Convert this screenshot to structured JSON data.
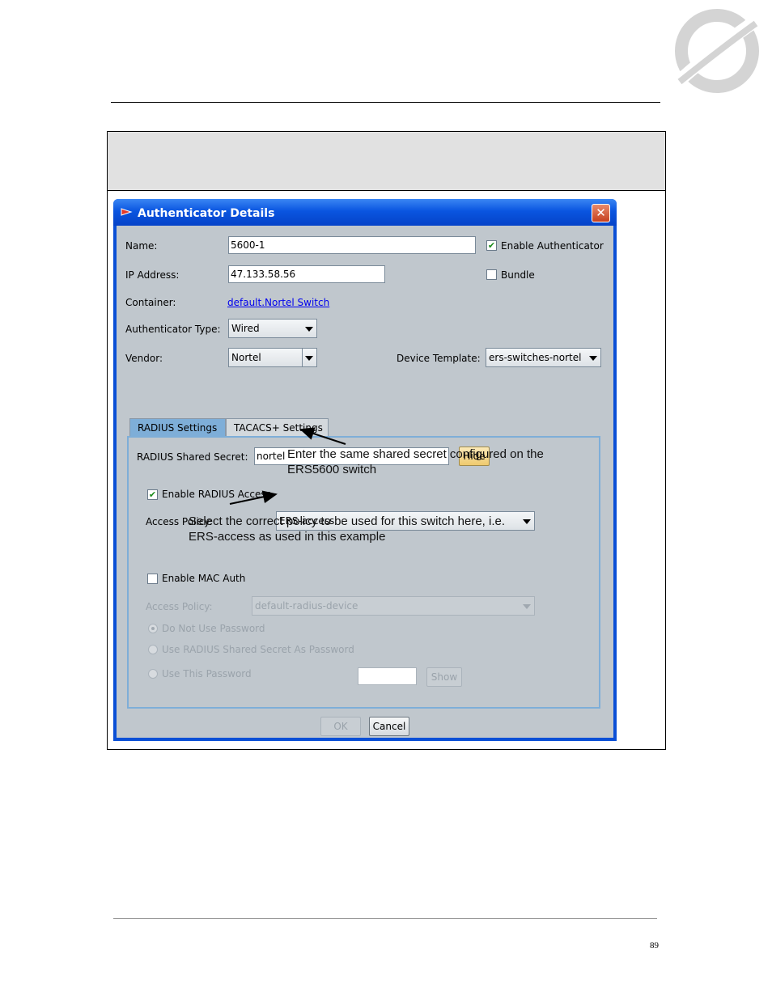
{
  "page": {
    "page_number": "89"
  },
  "dialog": {
    "title": "Authenticator Details",
    "close_symbol": "✕",
    "name_label": "Name:",
    "name_value": "5600-1",
    "enable_authenticator_label": "Enable Authenticator",
    "enable_authenticator_checked": true,
    "ip_label": "IP Address:",
    "ip_value": "47.133.58.56",
    "bundle_label": "Bundle",
    "bundle_checked": false,
    "container_label": "Container:",
    "container_value": "default.Nortel Switch",
    "auth_type_label": "Authenticator Type:",
    "auth_type_value": "Wired",
    "vendor_label": "Vendor:",
    "vendor_value": "Nortel",
    "device_template_label": "Device Template:",
    "device_template_value": "ers-switches-nortel",
    "tabs": [
      {
        "label": "RADIUS Settings",
        "active": true
      },
      {
        "label": "TACACS+ Settings",
        "active": false
      }
    ],
    "radius": {
      "shared_secret_label": "RADIUS Shared Secret:",
      "shared_secret_value": "nortel",
      "hide_button": "Hide",
      "enable_radius_access_label": "Enable RADIUS Access",
      "enable_radius_access_checked": true,
      "access_policy_label": "Access Policy:",
      "access_policy_value": "ERS-access",
      "enable_mac_auth_label": "Enable MAC Auth",
      "enable_mac_auth_checked": false,
      "mac_access_policy_label": "Access Policy:",
      "mac_access_policy_value": "default-radius-device",
      "radio_options": [
        "Do Not Use Password",
        "Use RADIUS Shared Secret As Password",
        "Use This Password"
      ],
      "show_button": "Show"
    },
    "ok_button": "OK",
    "cancel_button": "Cancel"
  },
  "annotations": {
    "secret_note_line1": "Enter the same shared secret configured on the",
    "secret_note_line2": "ERS5600 switch",
    "policy_note_line1": "Select the correct policy to be used for this switch here, i.e.",
    "policy_note_line2": "ERS-access as used in this example"
  },
  "colors": {
    "titlebar": "#0a55e0",
    "client_bg": "#c0c7cd",
    "active_tab": "#7eaed8",
    "link": "#0000ee"
  }
}
